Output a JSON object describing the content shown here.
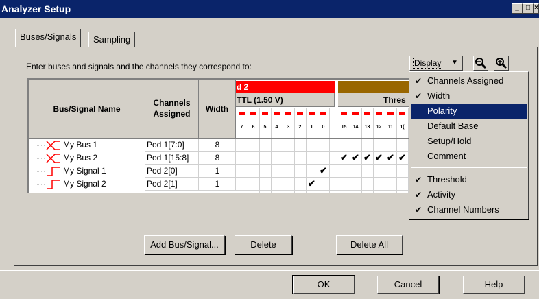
{
  "window": {
    "title": "Analyzer Setup"
  },
  "tabs": [
    {
      "label": "Buses/Signals",
      "active": true
    },
    {
      "label": "Sampling",
      "active": false
    }
  ],
  "instruction": "Enter buses and signals and the channels they correspond to:",
  "toolbar": {
    "display_label": "Display",
    "zoom_out": "zoom-out",
    "zoom_in": "zoom-in"
  },
  "table": {
    "headers": {
      "name": "Bus/Signal Name",
      "channels_1": "Channels",
      "channels_2": "Assigned",
      "width": "Width"
    },
    "pods": [
      {
        "label": "d 2",
        "color": "#ff0000",
        "threshold": "TTL (1.50 V)",
        "bits": [
          "7",
          "6",
          "5",
          "4",
          "3",
          "2",
          "1",
          "0"
        ]
      },
      {
        "label": "",
        "color": "#996600",
        "threshold": "Thres",
        "bits": [
          "15",
          "14",
          "13",
          "12",
          "11",
          "1("
        ]
      }
    ],
    "rows": [
      {
        "name": "My Bus 1",
        "channels": "Pod 1[7:0]",
        "width": "8",
        "type": "bus"
      },
      {
        "name": "My Bus 2",
        "channels": "Pod 1[15:8]",
        "width": "8",
        "type": "bus"
      },
      {
        "name": "My Signal 1",
        "channels": "Pod 2[0]",
        "width": "1",
        "type": "signal"
      },
      {
        "name": "My Signal 2",
        "channels": "Pod 2[1]",
        "width": "1",
        "type": "signal"
      }
    ],
    "checkmark": "✔"
  },
  "menu": {
    "items": [
      {
        "label": "Channels Assigned",
        "checked": true,
        "selected": false
      },
      {
        "label": "Width",
        "checked": true,
        "selected": false
      },
      {
        "label": "Polarity",
        "checked": false,
        "selected": true
      },
      {
        "label": "Default Base",
        "checked": false,
        "selected": false
      },
      {
        "label": "Setup/Hold",
        "checked": false,
        "selected": false
      },
      {
        "label": "Comment",
        "checked": false,
        "selected": false
      },
      {
        "label": "Threshold",
        "checked": true,
        "selected": false
      },
      {
        "label": "Activity",
        "checked": true,
        "selected": false
      },
      {
        "label": "Channel Numbers",
        "checked": true,
        "selected": false
      }
    ]
  },
  "buttons": {
    "add": "Add Bus/Signal...",
    "delete": "Delete",
    "delete_all": "Delete All",
    "ok": "OK",
    "cancel": "Cancel",
    "help": "Help"
  }
}
